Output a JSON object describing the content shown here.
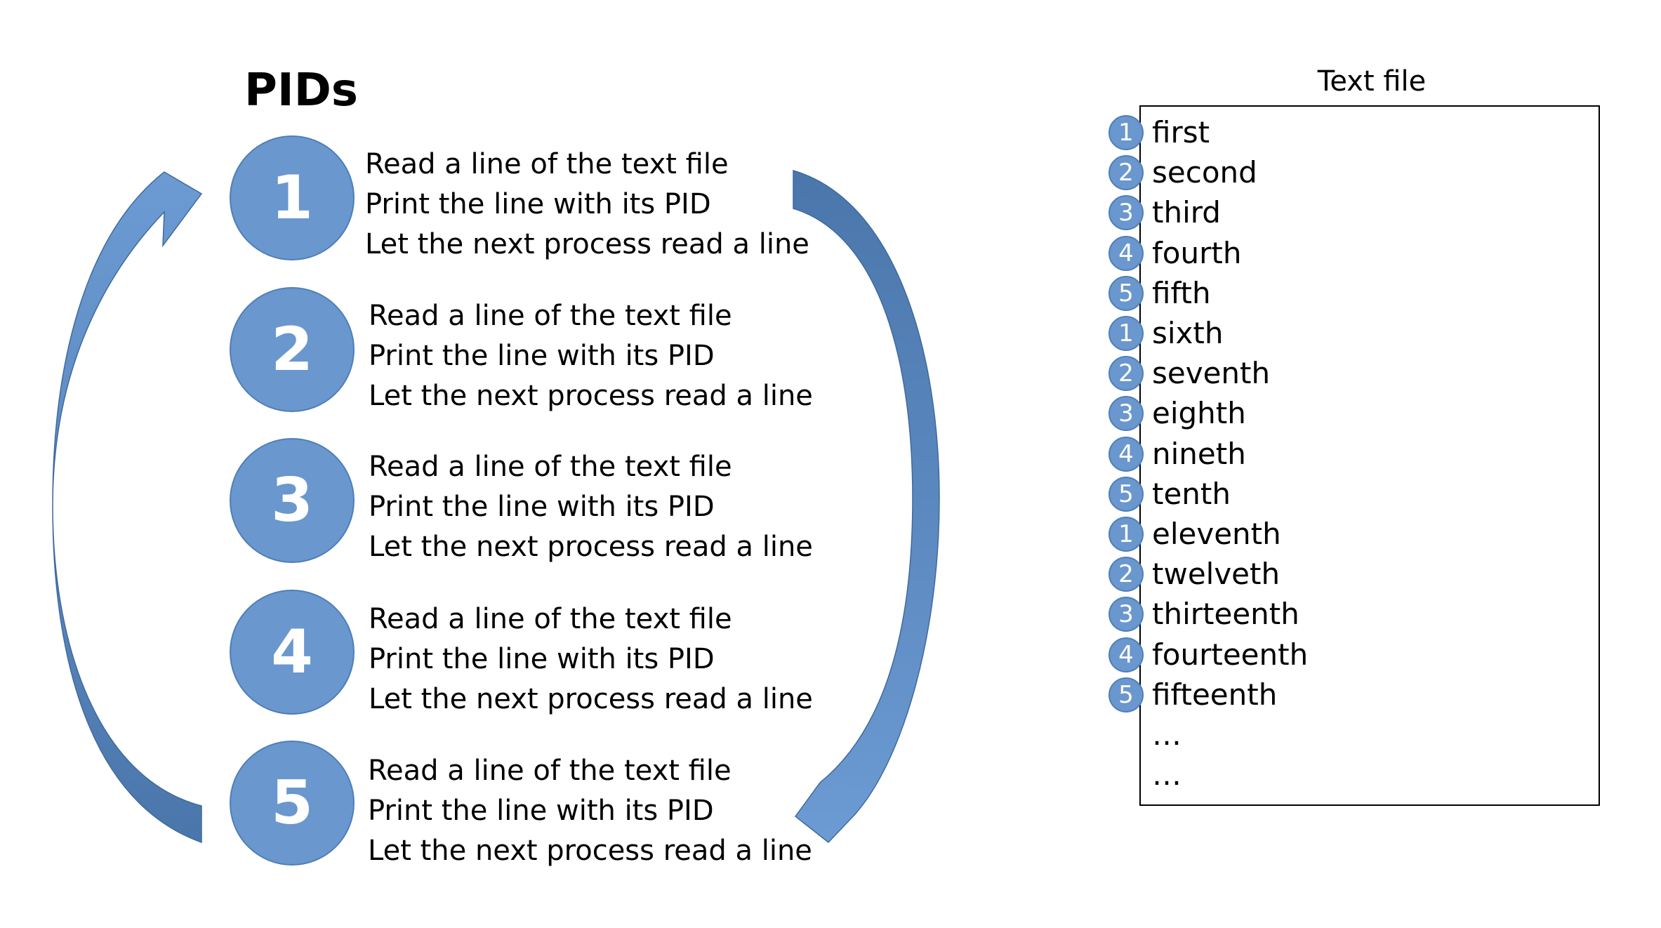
{
  "title": "PIDs",
  "accent_color": "#6a97cd",
  "arrow_color": "#5d89c0",
  "processes": [
    {
      "pid": "1",
      "steps": [
        "Read a line of the text file",
        "Print the line with its PID",
        "Let the next process read a line"
      ]
    },
    {
      "pid": "2",
      "steps": [
        "Read a line of the text file",
        "Print the line with its PID",
        "Let the next process read a line"
      ]
    },
    {
      "pid": "3",
      "steps": [
        "Read a line of the text file",
        "Print the line with its PID",
        "Let the next process read a line"
      ]
    },
    {
      "pid": "4",
      "steps": [
        "Read a line of the text file",
        "Print the line with its PID",
        "Let the next process read a line"
      ]
    },
    {
      "pid": "5",
      "steps": [
        "Read a line of the text file",
        "Print the line with its PID",
        "Let the next process read a line"
      ]
    }
  ],
  "text_file": {
    "title": "Text file",
    "lines": [
      {
        "pid": "1",
        "text": "first"
      },
      {
        "pid": "2",
        "text": "second"
      },
      {
        "pid": "3",
        "text": "third"
      },
      {
        "pid": "4",
        "text": "fourth"
      },
      {
        "pid": "5",
        "text": "fifth"
      },
      {
        "pid": "1",
        "text": "sixth"
      },
      {
        "pid": "2",
        "text": "seventh"
      },
      {
        "pid": "3",
        "text": "eighth"
      },
      {
        "pid": "4",
        "text": "nineth"
      },
      {
        "pid": "5",
        "text": "tenth"
      },
      {
        "pid": "1",
        "text": "eleventh"
      },
      {
        "pid": "2",
        "text": "twelveth"
      },
      {
        "pid": "3",
        "text": "thirteenth"
      },
      {
        "pid": "4",
        "text": "fourteenth"
      },
      {
        "pid": "5",
        "text": "fifteenth"
      },
      {
        "pid": "",
        "text": "…"
      },
      {
        "pid": "",
        "text": "…"
      }
    ]
  }
}
